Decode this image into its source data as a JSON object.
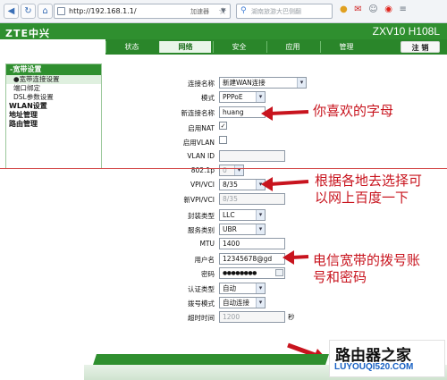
{
  "browser": {
    "url": "http://192.168.1.1/",
    "accelerator_label": "加速器",
    "search_placeholder": "湖南旅游大巴侧翻",
    "icons": [
      "back-icon",
      "refresh-icon",
      "home-icon",
      "star-icon",
      "search-icon",
      "mail-icon",
      "user-icon",
      "weibo-icon",
      "dropdown-icon",
      "menu-icon"
    ]
  },
  "router": {
    "logo": "ZTE中兴",
    "model": "ZXV10 H108L",
    "tabs": [
      "状态",
      "网络",
      "安全",
      "应用",
      "管理"
    ],
    "active_tab_index": 1,
    "logout_label": "注 销"
  },
  "sidebar": {
    "heading": "-宽带设置",
    "items": [
      "●宽带连接设置",
      "端口绑定",
      "DSL参数设置"
    ],
    "groups": [
      "WLAN设置",
      "地址管理",
      "路由管理"
    ]
  },
  "form": {
    "connection_name": {
      "label": "连接名称",
      "value": "新建WAN连接"
    },
    "mode": {
      "label": "模式",
      "value": "PPPoE"
    },
    "new_connection_name": {
      "label": "新连接名称",
      "value": "huang"
    },
    "enable_nat": {
      "label": "启用NAT",
      "checked": true
    },
    "enable_vlan": {
      "label": "启用VLAN",
      "checked": false
    },
    "vlan_id": {
      "label": "VLAN ID",
      "value": ""
    },
    "p8021": {
      "label": "802.1p",
      "value": "0"
    },
    "vpi_vci": {
      "label": "VPI/VCI",
      "value": "8/35"
    },
    "new_vpi_vci": {
      "label": "新VPI/VCI",
      "value": "8/35"
    },
    "encapsulation": {
      "label": "封装类型",
      "value": "LLC"
    },
    "service": {
      "label": "服务类别",
      "value": "UBR"
    },
    "mtu": {
      "label": "MTU",
      "value": "1400"
    },
    "username": {
      "label": "用户名",
      "value": "12345678@gd"
    },
    "password": {
      "label": "密码",
      "value": "●●●●●●●●"
    },
    "auth_type": {
      "label": "认证类型",
      "value": "自动"
    },
    "dial_mode": {
      "label": "拨号模式",
      "value": "自动连接"
    },
    "timeout": {
      "label": "超时时间",
      "value": "1200",
      "unit": "秒"
    }
  },
  "annotations": {
    "note1": "你喜欢的字母",
    "note2_line1": "根据各地去选择可",
    "note2_line2": "以网上百度一下",
    "note3_line1": "电信宽带的拨号账",
    "note3_line2": "号和密码"
  },
  "watermark": {
    "title": "路由器之家",
    "url": "LUYOUQI520.COM"
  },
  "colors": {
    "brand_green": "#2f8f2f",
    "annotation_red": "#c8141e"
  }
}
